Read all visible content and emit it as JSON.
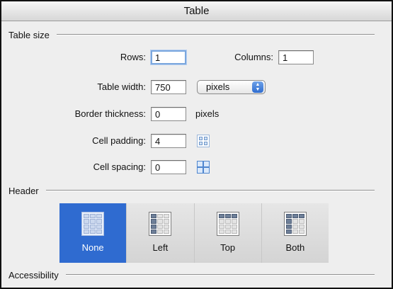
{
  "window": {
    "title": "Table"
  },
  "sections": {
    "table_size": "Table size",
    "header": "Header",
    "accessibility": "Accessibility"
  },
  "table_size": {
    "rows": {
      "label": "Rows:",
      "value": "1"
    },
    "columns": {
      "label": "Columns:",
      "value": "1"
    },
    "table_width": {
      "label": "Table width:",
      "value": "750",
      "unit_selected": "pixels"
    },
    "border_thickness": {
      "label": "Border thickness:",
      "value": "0",
      "unit": "pixels"
    },
    "cell_padding": {
      "label": "Cell padding:",
      "value": "4"
    },
    "cell_spacing": {
      "label": "Cell spacing:",
      "value": "0"
    }
  },
  "header_options": [
    {
      "label": "None",
      "selected": true
    },
    {
      "label": "Left",
      "selected": false
    },
    {
      "label": "Top",
      "selected": false
    },
    {
      "label": "Both",
      "selected": false
    }
  ],
  "colors": {
    "selection": "#2f6bd0",
    "focus_ring": "#7ba7de",
    "dialog_bg": "#eeeeee"
  }
}
